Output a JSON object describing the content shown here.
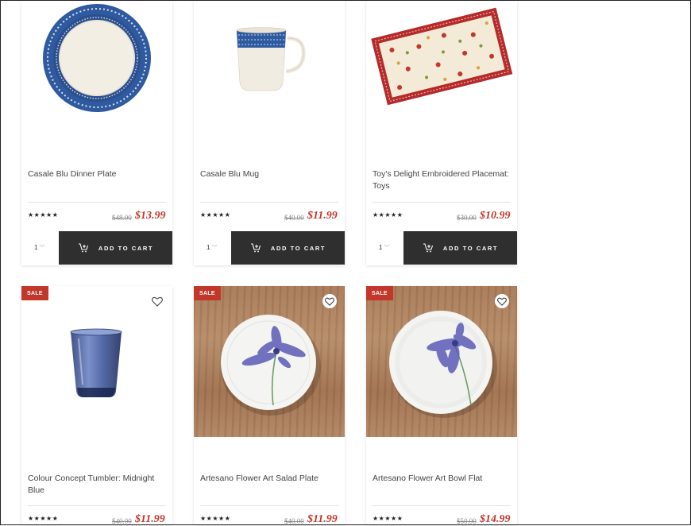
{
  "products": [
    {
      "title": "Casale Blu Dinner Plate",
      "stars": "★★★★★",
      "old_price": "$48.00",
      "new_price": "$13.99",
      "qty": "1",
      "cart_label": "ADD TO CART"
    },
    {
      "title": "Casale Blu Mug",
      "stars": "★★★★★",
      "old_price": "$40.00",
      "new_price": "$11.99",
      "qty": "1",
      "cart_label": "ADD TO CART"
    },
    {
      "title": "Toy's Delight Embroidered Placemat: Toys",
      "stars": "★★★★★",
      "old_price": "$30.00",
      "new_price": "$10.99",
      "qty": "1",
      "cart_label": "ADD TO CART"
    },
    {
      "title": "Colour Concept Tumbler: Midnight Blue",
      "badge": "SALE",
      "stars": "★★★★★",
      "old_price": "$40.00",
      "new_price": "$11.99"
    },
    {
      "title": "Artesano Flower Art Salad Plate",
      "badge": "SALE",
      "stars": "★★★★★",
      "old_price": "$40.00",
      "new_price": "$11.99"
    },
    {
      "title": "Artesano Flower Art Bowl Flat",
      "badge": "SALE",
      "stars": "★★★★★",
      "old_price": "$50.00",
      "new_price": "$14.99"
    }
  ],
  "icons": {
    "cart": "cart-plus-icon",
    "wishlist": "heart-icon",
    "dropdown": "chevron-down-icon"
  },
  "colors": {
    "sale_red": "#c2372a",
    "button_dark": "#2f2f2f"
  }
}
